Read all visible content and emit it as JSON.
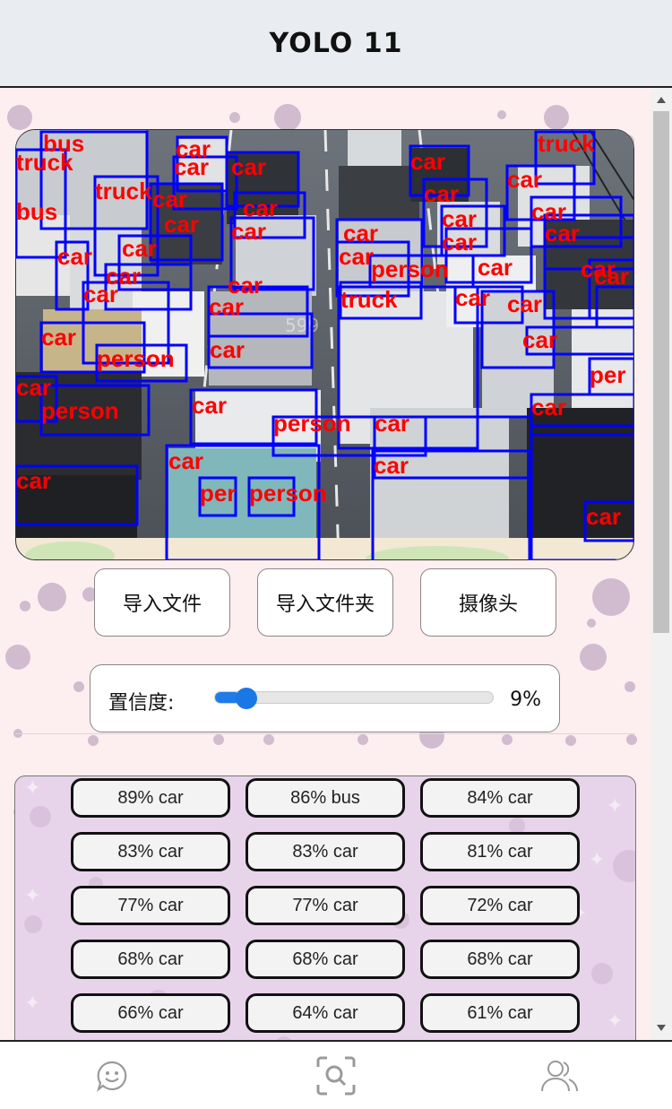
{
  "header": {
    "title": "YOLO 11"
  },
  "preview": {
    "watermark": "599",
    "detections": [
      {
        "label": "bus",
        "color": "#ff1010"
      },
      {
        "label": "truck",
        "color": "#ff1010"
      },
      {
        "label": "car",
        "color": "#ff1010"
      },
      {
        "label": "person",
        "color": "#ff1010"
      }
    ]
  },
  "buttons": {
    "import_file": "导入文件",
    "import_folder": "导入文件夹",
    "camera": "摄像头"
  },
  "confidence": {
    "label": "置信度:",
    "value_text": "9%",
    "value": 0.09
  },
  "results": [
    "89% car",
    "86% bus",
    "84% car",
    "83% car",
    "83% car",
    "81% car",
    "77% car",
    "77% car",
    "72% car",
    "68% car",
    "68% car",
    "68% car",
    "66% car",
    "64% car",
    "61% car"
  ],
  "tabs": [
    {
      "icon": "smiley-icon"
    },
    {
      "icon": "scan-search-icon"
    },
    {
      "icon": "users-icon"
    }
  ],
  "colors": {
    "accent": "#1f7be8",
    "box": "#0000ff",
    "label": "#ff0000"
  }
}
